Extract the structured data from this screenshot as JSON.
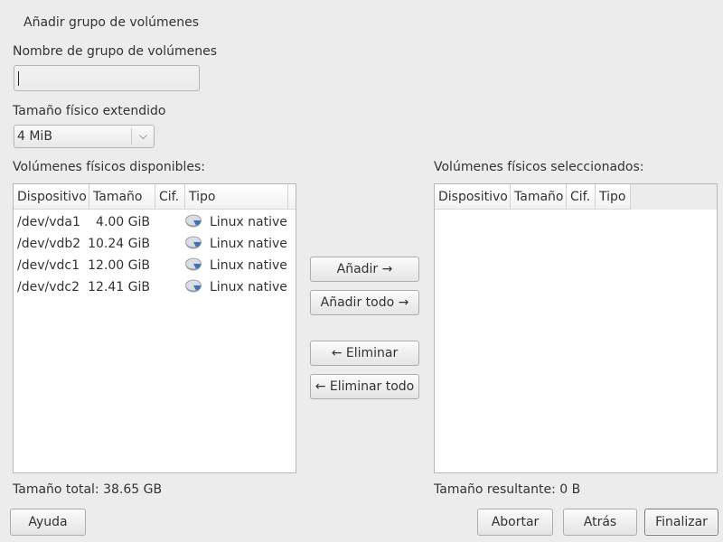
{
  "dialog_title": "Añadir grupo de volúmenes",
  "vg_name": {
    "label": "Nombre de grupo de volúmenes",
    "value": ""
  },
  "extent": {
    "label": "Tamaño físico extendido",
    "selected": "4 MiB"
  },
  "available": {
    "label": "Volúmenes físicos disponibles:",
    "columns": [
      "Dispositivo",
      "Tamaño",
      "Cif.",
      "Tipo"
    ],
    "rows": [
      {
        "device": "/dev/vda1",
        "size": "4.00 GiB",
        "encrypted": "",
        "type": "Linux native",
        "icon": "disk-icon"
      },
      {
        "device": "/dev/vdb2",
        "size": "10.24 GiB",
        "encrypted": "",
        "type": "Linux native",
        "icon": "disk-icon"
      },
      {
        "device": "/dev/vdc1",
        "size": "12.00 GiB",
        "encrypted": "",
        "type": "Linux native",
        "icon": "disk-icon"
      },
      {
        "device": "/dev/vdc2",
        "size": "12.41 GiB",
        "encrypted": "",
        "type": "Linux native",
        "icon": "disk-icon"
      }
    ],
    "total": "Tamaño total: 38.65 GB"
  },
  "selected": {
    "label": "Volúmenes físicos seleccionados:",
    "columns": [
      "Dispositivo",
      "Tamaño",
      "Cif.",
      "Tipo"
    ],
    "rows": [],
    "total": "Tamaño resultante: 0 B"
  },
  "transfer_buttons": {
    "add": "Añadir →",
    "add_all": "Añadir todo →",
    "remove": "← Eliminar",
    "remove_all": "← Eliminar todo"
  },
  "footer": {
    "help": "Ayuda",
    "abort": "Abortar",
    "back": "Atrás",
    "finish": "Finalizar"
  }
}
